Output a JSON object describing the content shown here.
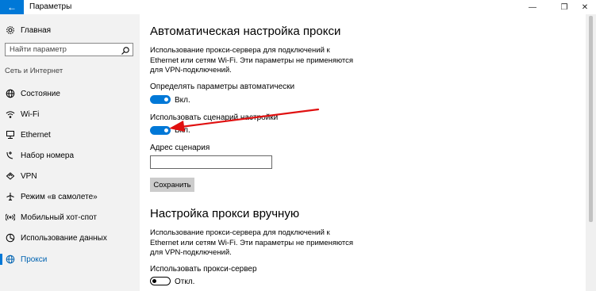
{
  "window": {
    "title": "Параметры",
    "back": "←",
    "minimize": "—",
    "maximize": "❐",
    "close": "✕"
  },
  "sidebar": {
    "home": "Главная",
    "search_placeholder": "Найти параметр",
    "section": "Сеть и Интернет",
    "items": [
      {
        "label": "Состояние",
        "icon": "globe-icon"
      },
      {
        "label": "Wi-Fi",
        "icon": "wifi-icon"
      },
      {
        "label": "Ethernet",
        "icon": "ethernet-icon"
      },
      {
        "label": "Набор номера",
        "icon": "dialup-icon"
      },
      {
        "label": "VPN",
        "icon": "vpn-icon"
      },
      {
        "label": "Режим «в самолете»",
        "icon": "airplane-icon"
      },
      {
        "label": "Мобильный хот-спот",
        "icon": "hotspot-icon"
      },
      {
        "label": "Использование данных",
        "icon": "data-usage-icon"
      },
      {
        "label": "Прокси",
        "icon": "globe-icon",
        "active": true
      }
    ]
  },
  "auto": {
    "title": "Автоматическая настройка прокси",
    "desc": "Использование прокси-сервера для подключений к Ethernet или сетям Wi-Fi. Эти параметры не применяются для VPN-подключений.",
    "detect_label": "Определять параметры автоматически",
    "detect_state": "Вкл.",
    "script_label": "Использовать сценарий настройки",
    "script_state": "Вкл.",
    "address_label": "Адрес сценария",
    "address_value": "",
    "save": "Сохранить"
  },
  "manual": {
    "title": "Настройка прокси вручную",
    "desc": "Использование прокси-сервера для подключений к Ethernet или сетям Wi-Fi. Эти параметры не применяются для VPN-подключений.",
    "proxy_label": "Использовать прокси-сервер",
    "proxy_state": "Откл."
  },
  "colors": {
    "accent": "#0078d7",
    "annotation": "#e01010"
  }
}
